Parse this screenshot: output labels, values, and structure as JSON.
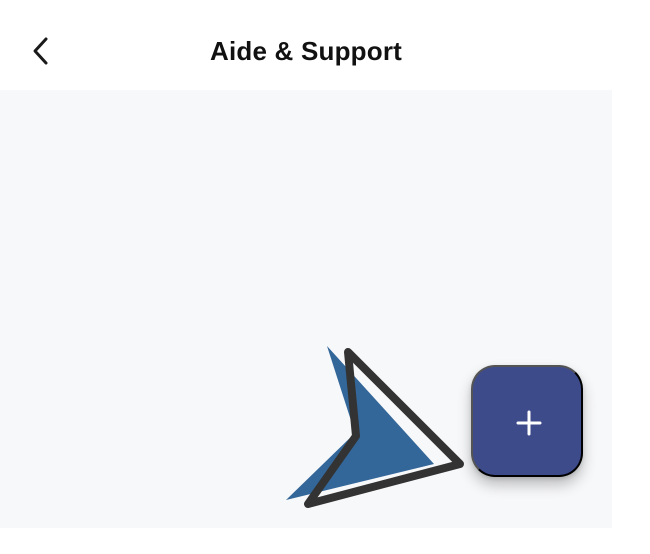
{
  "header": {
    "title": "Aide & Support",
    "back_icon": "chevron-left-icon"
  },
  "illustration": {
    "icon": "pointer-arrow-icon",
    "colors": {
      "fill": "#336699",
      "outline": "#333333"
    }
  },
  "fab": {
    "icon": "plus-icon",
    "color": "#3d4b8b"
  },
  "colors": {
    "background": "#ffffff",
    "content_background": "#f7f8fa",
    "title_text": "#111111"
  }
}
